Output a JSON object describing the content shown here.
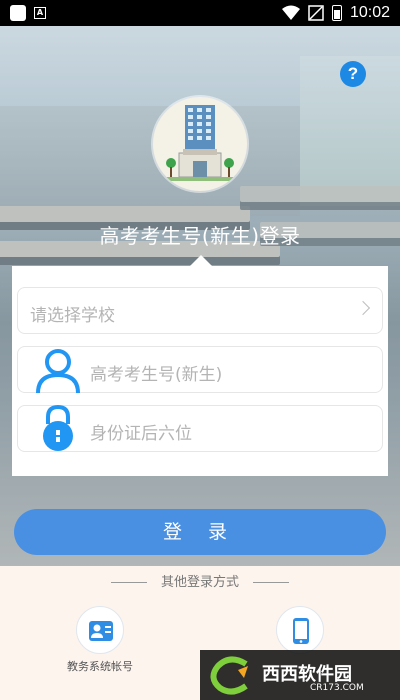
{
  "status_bar": {
    "time": "10:02",
    "left_glyph": "A"
  },
  "header": {
    "help_label": "?",
    "title": "高考考生号(新生)登录"
  },
  "form": {
    "school": {
      "placeholder": "请选择学校"
    },
    "exam_id": {
      "placeholder": "高考考生号(新生)"
    },
    "id_card": {
      "placeholder": "身份证后六位"
    },
    "login_label": "登 录"
  },
  "other_login": {
    "heading": "其他登录方式",
    "options": [
      {
        "label": "教务系统帐号",
        "icon": "account-card-icon"
      },
      {
        "label": "",
        "icon": "phone-icon"
      }
    ]
  },
  "watermark": {
    "brand": "西西软件园",
    "url": "CR173.COM"
  },
  "colors": {
    "primary": "#4a90e2",
    "help": "#1e88e5",
    "background": "#fdf4ee"
  }
}
